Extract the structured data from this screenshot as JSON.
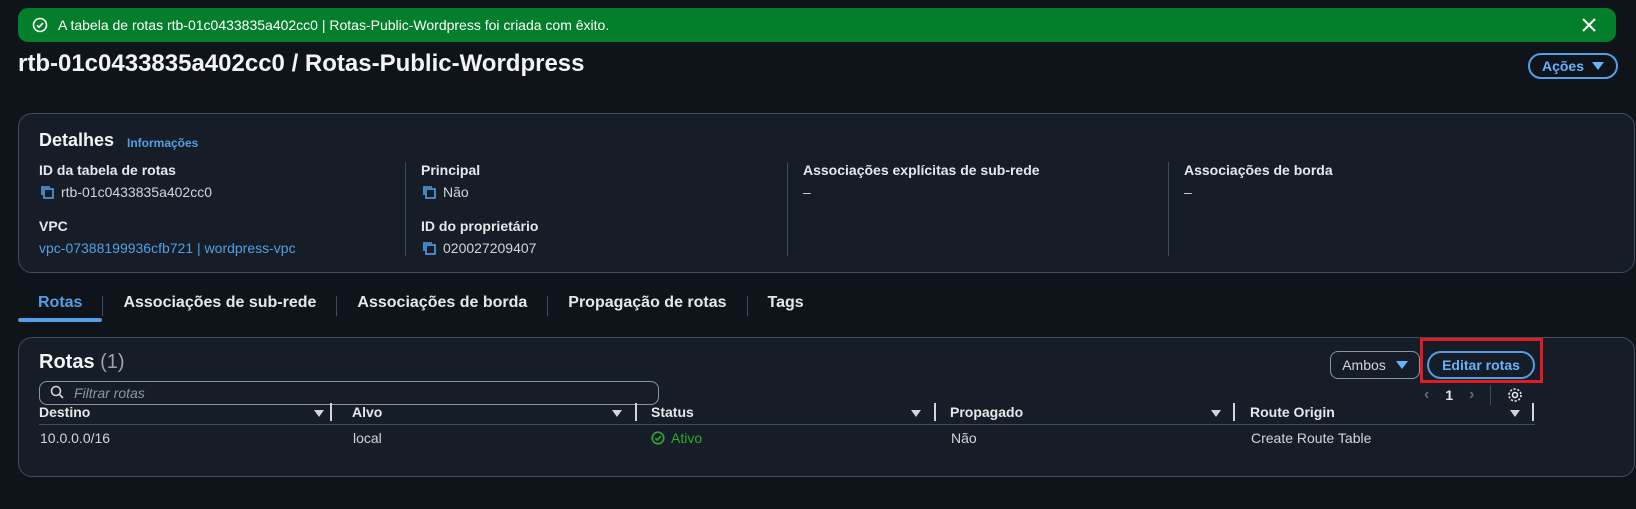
{
  "flash": {
    "message": "A tabela de rotas rtb-01c0433835a402cc0 | Rotas-Public-Wordpress foi criada com êxito.",
    "icons": {
      "status": "check-circle-icon",
      "close": "close-icon"
    },
    "color": "#037f2c"
  },
  "header": {
    "title": "rtb-01c0433835a402cc0 / Rotas-Public-Wordpress",
    "actions_label": "Ações"
  },
  "details": {
    "title": "Detalhes",
    "info_link": "Informações",
    "route_table_id": {
      "label": "ID da tabela de rotas",
      "value": "rtb-01c0433835a402cc0"
    },
    "vpc": {
      "label": "VPC",
      "value": "vpc-07388199936cfb721 | wordpress-vpc"
    },
    "main": {
      "label": "Principal",
      "value": "Não"
    },
    "owner_id": {
      "label": "ID do proprietário",
      "value": "020027209407"
    },
    "explicit_subnets": {
      "label": "Associações explícitas de sub-rede",
      "value": "–"
    },
    "edge_assoc": {
      "label": "Associações de borda",
      "value": "–"
    }
  },
  "tabs": [
    {
      "label": "Rotas",
      "active": true
    },
    {
      "label": "Associações de sub-rede",
      "active": false
    },
    {
      "label": "Associações de borda",
      "active": false
    },
    {
      "label": "Propagação de rotas",
      "active": false
    },
    {
      "label": "Tags",
      "active": false
    }
  ],
  "routes": {
    "title": "Rotas",
    "count": "(1)",
    "filter_dropdown": "Ambos",
    "edit_label": "Editar rotas",
    "filter_placeholder": "Filtrar rotas",
    "page": "1",
    "columns": [
      "Destino",
      "Alvo",
      "Status",
      "Propagado",
      "Route Origin"
    ],
    "rows": [
      {
        "destino": "10.0.0.0/16",
        "alvo": "local",
        "status": "Ativo",
        "propagado": "Não",
        "origin": "Create Route Table"
      }
    ]
  },
  "colors": {
    "accent": "#539fe5",
    "success": "#29ad32",
    "highlight": "#e11b22",
    "background": "#0f141a"
  }
}
